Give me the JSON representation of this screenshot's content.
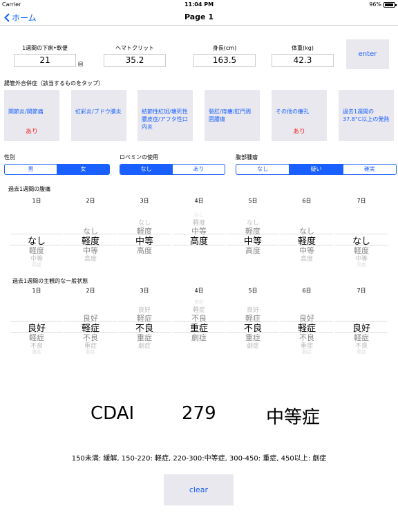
{
  "status": {
    "carrier": "Carrier",
    "time": "11:04 PM",
    "battery": "96%",
    "battery_level": 0.96
  },
  "nav": {
    "back_label": "ホーム",
    "title": "Page 1"
  },
  "inputs": {
    "diarrhea": {
      "label": "1週間の下痢•軟便",
      "value": "21",
      "unit": "回"
    },
    "hematocrit": {
      "label": "ヘマトクリット",
      "value": "35.2"
    },
    "height": {
      "label": "身長(cm)",
      "value": "163.5"
    },
    "weight": {
      "label": "体重(kg)",
      "value": "42.3"
    },
    "enter_label": "enter"
  },
  "complications": {
    "heading": "腸管外合併症（該当するものをタップ）",
    "tiles": [
      {
        "label": "関節炎/関節痛",
        "state": "あり"
      },
      {
        "label": "虹彩炎/ブドウ膜炎",
        "state": ""
      },
      {
        "label": "結節性紅斑/壊死性膿皮症/アフタ性口内炎",
        "state": ""
      },
      {
        "label": "裂肛/痔瘻/肛門周囲膿瘍",
        "state": ""
      },
      {
        "label": "その他の瘻孔",
        "state": "あり"
      },
      {
        "label": "過去1週間の37.8°C以上の発熱",
        "state": ""
      }
    ]
  },
  "sex": {
    "label": "性別",
    "options": [
      "男",
      "女"
    ],
    "selected": 1
  },
  "lomotil": {
    "label": "ロペミンの使用",
    "options": [
      "なし",
      "あり"
    ],
    "selected": 0
  },
  "mass": {
    "label": "腹部腫瘤",
    "options": [
      "なし",
      "疑い",
      "確実"
    ],
    "selected": 1
  },
  "pain": {
    "label": "過去1週間の腹痛",
    "days": [
      "1日",
      "2日",
      "3日",
      "4日",
      "5日",
      "6日",
      "7日"
    ],
    "options": [
      "なし",
      "軽度",
      "中等",
      "高度"
    ],
    "selected": [
      0,
      1,
      2,
      3,
      2,
      1,
      0
    ]
  },
  "general": {
    "label": "過去1週間の主観的な一般状態",
    "days": [
      "1日",
      "2日",
      "3日",
      "4日",
      "5日",
      "6日",
      "7日"
    ],
    "options": [
      "良好",
      "軽症",
      "不良",
      "重症",
      "劇症"
    ],
    "selected": [
      0,
      1,
      2,
      3,
      2,
      1,
      0
    ]
  },
  "result": {
    "label": "CDAI",
    "score": "279",
    "severity": "中等症"
  },
  "legend": "150未満: 緩解, 150-220: 軽症, 220-300:中等症, 300-450: 重症, 450以上: 劇症",
  "clear_label": "clear"
}
